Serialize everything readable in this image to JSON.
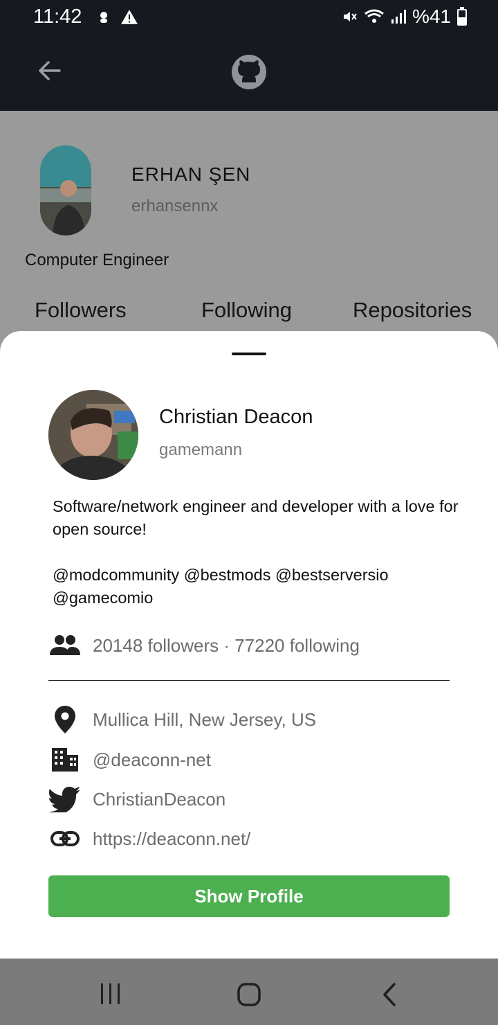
{
  "status": {
    "time": "11:42",
    "battery": "%41"
  },
  "background_profile": {
    "name": "ERHAN ŞEN",
    "username": "erhansennx",
    "bio": "Computer Engineer",
    "tabs": [
      "Followers",
      "Following",
      "Repositories"
    ]
  },
  "sheet": {
    "name": "Christian Deacon",
    "login": "gamemann",
    "bio": "Software/network engineer and developer with a love for open source!\n\n@modcommunity @bestmods @bestserversio @gamecomio",
    "followers_text": "20148 followers · 77220 following",
    "location": "Mullica Hill, New Jersey, US",
    "company": "@deaconn-net",
    "twitter": "ChristianDeacon",
    "blog": "https://deaconn.net/",
    "button": "Show Profile"
  },
  "icons": {
    "back": "back-arrow-icon",
    "logo": "github-icon",
    "people": "people-icon",
    "location": "location-pin-icon",
    "company": "building-icon",
    "twitter": "twitter-icon",
    "link": "link-icon"
  },
  "colors": {
    "accent": "#4caf50",
    "appbar": "#161a20",
    "scrim": "#9a9a9a"
  }
}
